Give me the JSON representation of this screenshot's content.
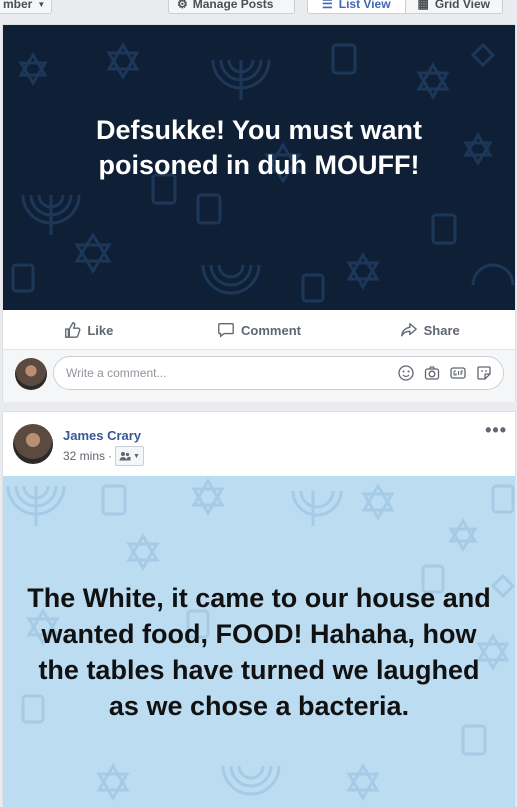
{
  "toolbar": {
    "filter_label": "mber",
    "manage_label": "Manage Posts",
    "list_view_label": "List View",
    "grid_view_label": "Grid View"
  },
  "posts": [
    {
      "text": "Defsukke! You must want poisoned in duh MOUFF!",
      "actions": {
        "like": "Like",
        "comment": "Comment",
        "share": "Share"
      },
      "comment_placeholder": "Write a comment..."
    },
    {
      "author": "James Crary",
      "time": "32 mins",
      "text": "The White, it came to our house and wanted food, FOOD! Hahaha, how the tables have turned we laughed as we chose a bacteria."
    }
  ],
  "colors": {
    "dark_background": "#0e1f36",
    "light_background": "#bcdcf1",
    "link": "#365899",
    "accent": "#4267b2"
  }
}
